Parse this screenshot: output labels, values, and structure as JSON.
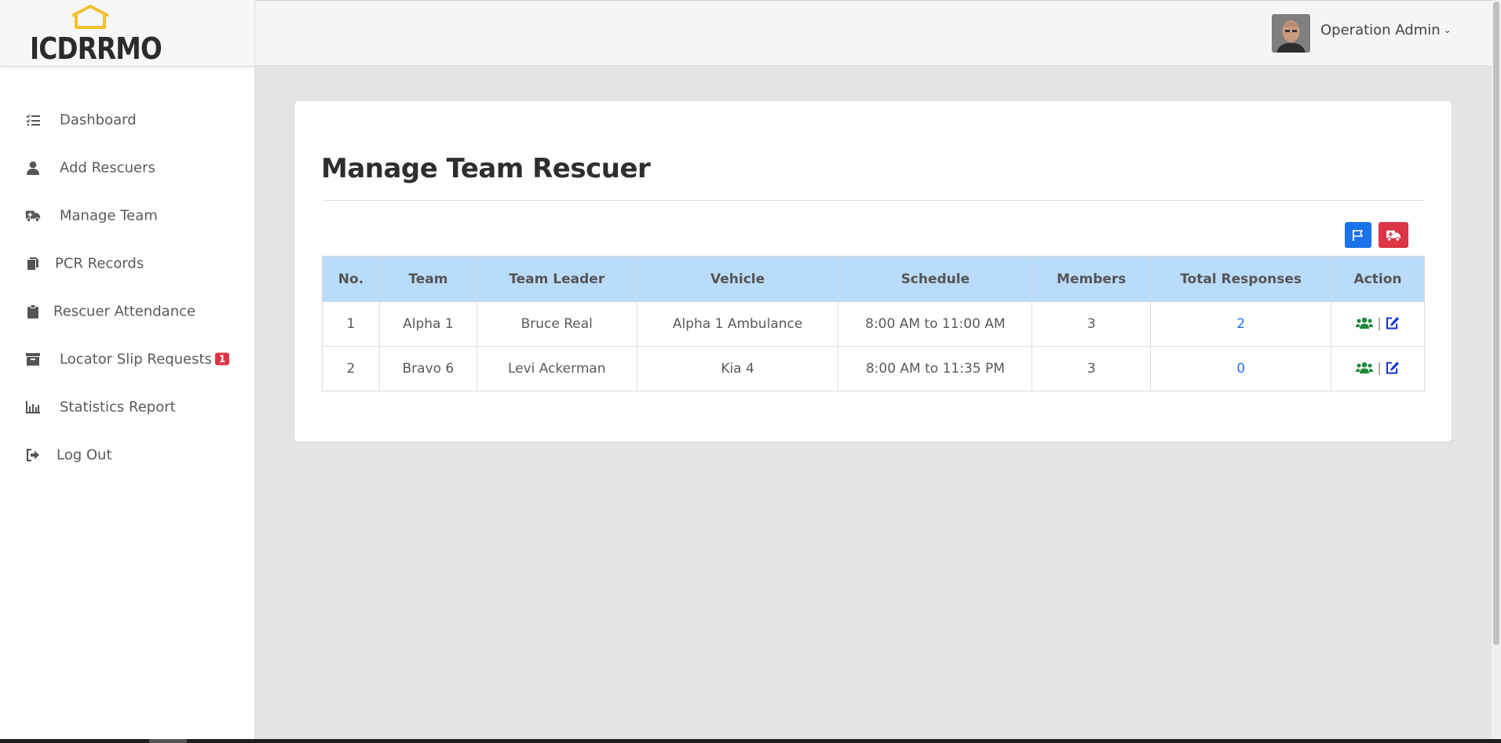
{
  "brand": {
    "name": "ICDRRMO",
    "house_color": "#f2c12e"
  },
  "sidebar": {
    "items": [
      {
        "label": "Dashboard",
        "icon": "list-check-icon"
      },
      {
        "label": "Add Rescuers",
        "icon": "user-icon"
      },
      {
        "label": "Manage Team",
        "icon": "ambulance-icon"
      },
      {
        "label": "PCR Records",
        "icon": "copy-icon"
      },
      {
        "label": "Rescuer Attendance",
        "icon": "clipboard-icon"
      },
      {
        "label": "Locator Slip Requests",
        "icon": "archive-icon",
        "badge": "1"
      },
      {
        "label": "Statistics Report",
        "icon": "bar-chart-icon"
      },
      {
        "label": "Log Out",
        "icon": "sign-out-icon"
      }
    ]
  },
  "header": {
    "user_name": "Operation Admin",
    "caret": "⌄"
  },
  "main": {
    "title": "Manage Team Rescuer",
    "toolbar": {
      "flag_button_icon": "flag-icon",
      "ambulance_button_icon": "ambulance-icon"
    },
    "table": {
      "headers": [
        "No.",
        "Team",
        "Team Leader",
        "Vehicle",
        "Schedule",
        "Members",
        "Total Responses",
        "Action"
      ],
      "rows": [
        {
          "no": "1",
          "team": "Alpha 1",
          "leader": "Bruce Real",
          "vehicle": "Alpha 1 Ambulance",
          "schedule": "8:00 AM to 11:00 AM",
          "members": "3",
          "responses": "2"
        },
        {
          "no": "2",
          "team": "Bravo 6",
          "leader": "Levi Ackerman",
          "vehicle": "Kia 4",
          "schedule": "8:00 AM to 11:35 PM",
          "members": "3",
          "responses": "0"
        }
      ],
      "action_separator": "|"
    }
  },
  "colors": {
    "accent_blue": "#1a73e8",
    "danger_red": "#dc3545",
    "table_header": "#b9dcfb",
    "members_icon_green": "#1e8a3c",
    "edit_icon_blue": "#1433d6"
  }
}
